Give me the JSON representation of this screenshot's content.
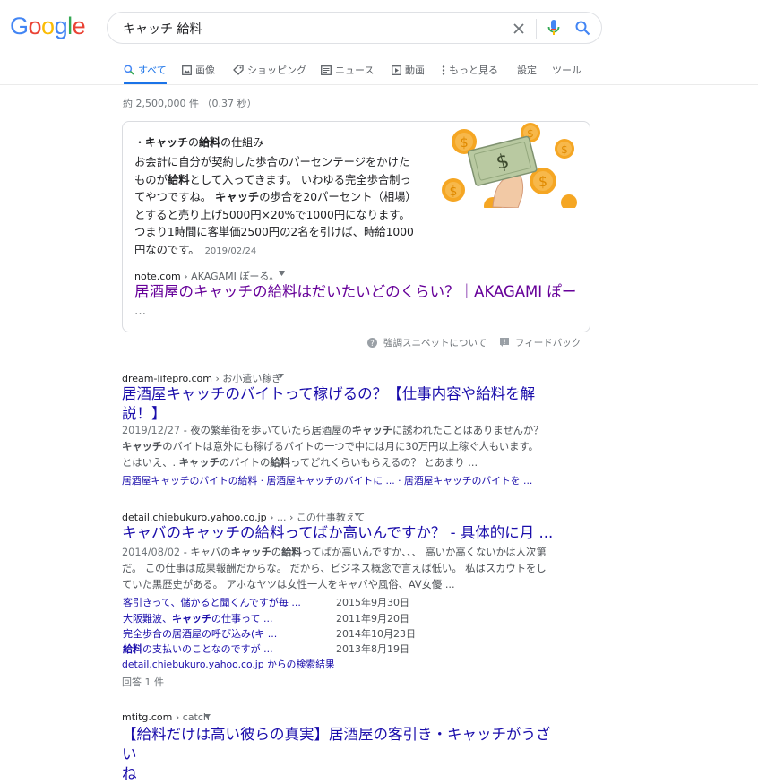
{
  "logo": {
    "letters": [
      "G",
      "o",
      "o",
      "g",
      "l",
      "e"
    ],
    "colors": [
      "#4285f4",
      "#ea4335",
      "#fbbc05",
      "#4285f4",
      "#34a853",
      "#ea4335"
    ]
  },
  "search": {
    "query": "キャッチ 給料"
  },
  "tabs": [
    {
      "label": "すべて"
    },
    {
      "label": "画像"
    },
    {
      "label": "ショッピング"
    },
    {
      "label": "ニュース"
    },
    {
      "label": "動画"
    },
    {
      "label": "もっと見る"
    },
    {
      "label": "設定"
    },
    {
      "label": "ツール"
    }
  ],
  "stats": "約 2,500,000 件 （0.37 秒）",
  "snippet": {
    "title_prefix": "・",
    "title_bold1": "キャッチ",
    "title_mid": "の",
    "title_bold2": "給料",
    "title_suffix": "の仕組み",
    "body_parts": [
      "お会計に自分が契約した歩合のパーセンテージをかけたものが",
      "給料",
      "として入ってきます。 いわゆる完全歩合制ってやつですね。 ",
      "キャッチ",
      "の歩合を20パーセント（相場）とすると売り上げ5000円×20%で1000円になります。 つまり1時間に客単価2500円の2名を引けば、時給1000円なのです。"
    ],
    "date": "2019/02/24",
    "cite_domain": "note.com",
    "cite_path": " › AKAGAMI ぽーる。",
    "link_title": "居酒屋のキャッチの給料はだいたいどのくらい？｜AKAGAMI ぽー",
    "link_ellipsis": "…",
    "about": "強調スニペットについて",
    "feedback": "フィードバック"
  },
  "results": [
    {
      "domain": "dream-lifepro.com",
      "path": " › お小遣い稼ぎ",
      "title_line1": "居酒屋キャッチのバイトって稼げるの？【仕事内容や給料を解",
      "title_line2": "説！】",
      "date": "2019/12/27",
      "desc_parts": [
        " - 夜の繁華街を歩いていたら居酒屋の",
        "キャッチ",
        "に誘われたことはありませんか？ ",
        "キャッチ",
        "のバイトは意外にも稼げるバイトの一つで中には月に30万円以上稼ぐ人もいます。 とはいえ、. ",
        "キャッチ",
        "のバイトの",
        "給料",
        "ってどれくらいもらえるの？ とあまり ..."
      ],
      "sitelinks": "居酒屋キャッチのバイトの給料 · 居酒屋キャッチのバイトに ... · 居酒屋キャッチのバイトを ..."
    },
    {
      "domain": "detail.chiebukuro.yahoo.co.jp",
      "path": " › ... › この仕事教えて",
      "title_line1": "キャバのキャッチの給料ってばか高いんですか？ - 具体的に月 ...",
      "date": "2014/08/02",
      "desc_parts": [
        " - キャバの",
        "キャッチ",
        "の",
        "給料",
        "ってばか高いんですか、、、 高いか高くないかは人次第だ。 この仕事は成果報酬だからな。 だから、ビジネス概念で言えば低い。 私はスカウトをしていた黒歴史がある。 アホなヤツは女性一人をキャバや風俗、AV女優 ..."
      ],
      "qa": [
        {
          "prefix": "客引きって、儲かると聞くんですが毎 ...",
          "bold": "",
          "suffix": "",
          "date": "2015年9月30日"
        },
        {
          "prefix": "大阪難波、",
          "bold": "キャッチ",
          "suffix": "の仕事って ...",
          "date": "2011年9月20日"
        },
        {
          "prefix": "完全歩合の居酒屋の呼び込み(キ ...",
          "bold": "",
          "suffix": "",
          "date": "2014年10月23日"
        },
        {
          "prefix": "",
          "bold": "給料",
          "suffix": "の支払いのことなのですが ...",
          "date": "2013年8月19日"
        }
      ],
      "more": "detail.chiebukuro.yahoo.co.jp からの検索結果",
      "answers": "回答 1 件"
    },
    {
      "domain": "mtitg.com",
      "path": " › catch",
      "title_line1": "【給料だけは高い彼らの真実】居酒屋の客引き・キャッチがうざい",
      "title_line2": "ね"
    }
  ]
}
